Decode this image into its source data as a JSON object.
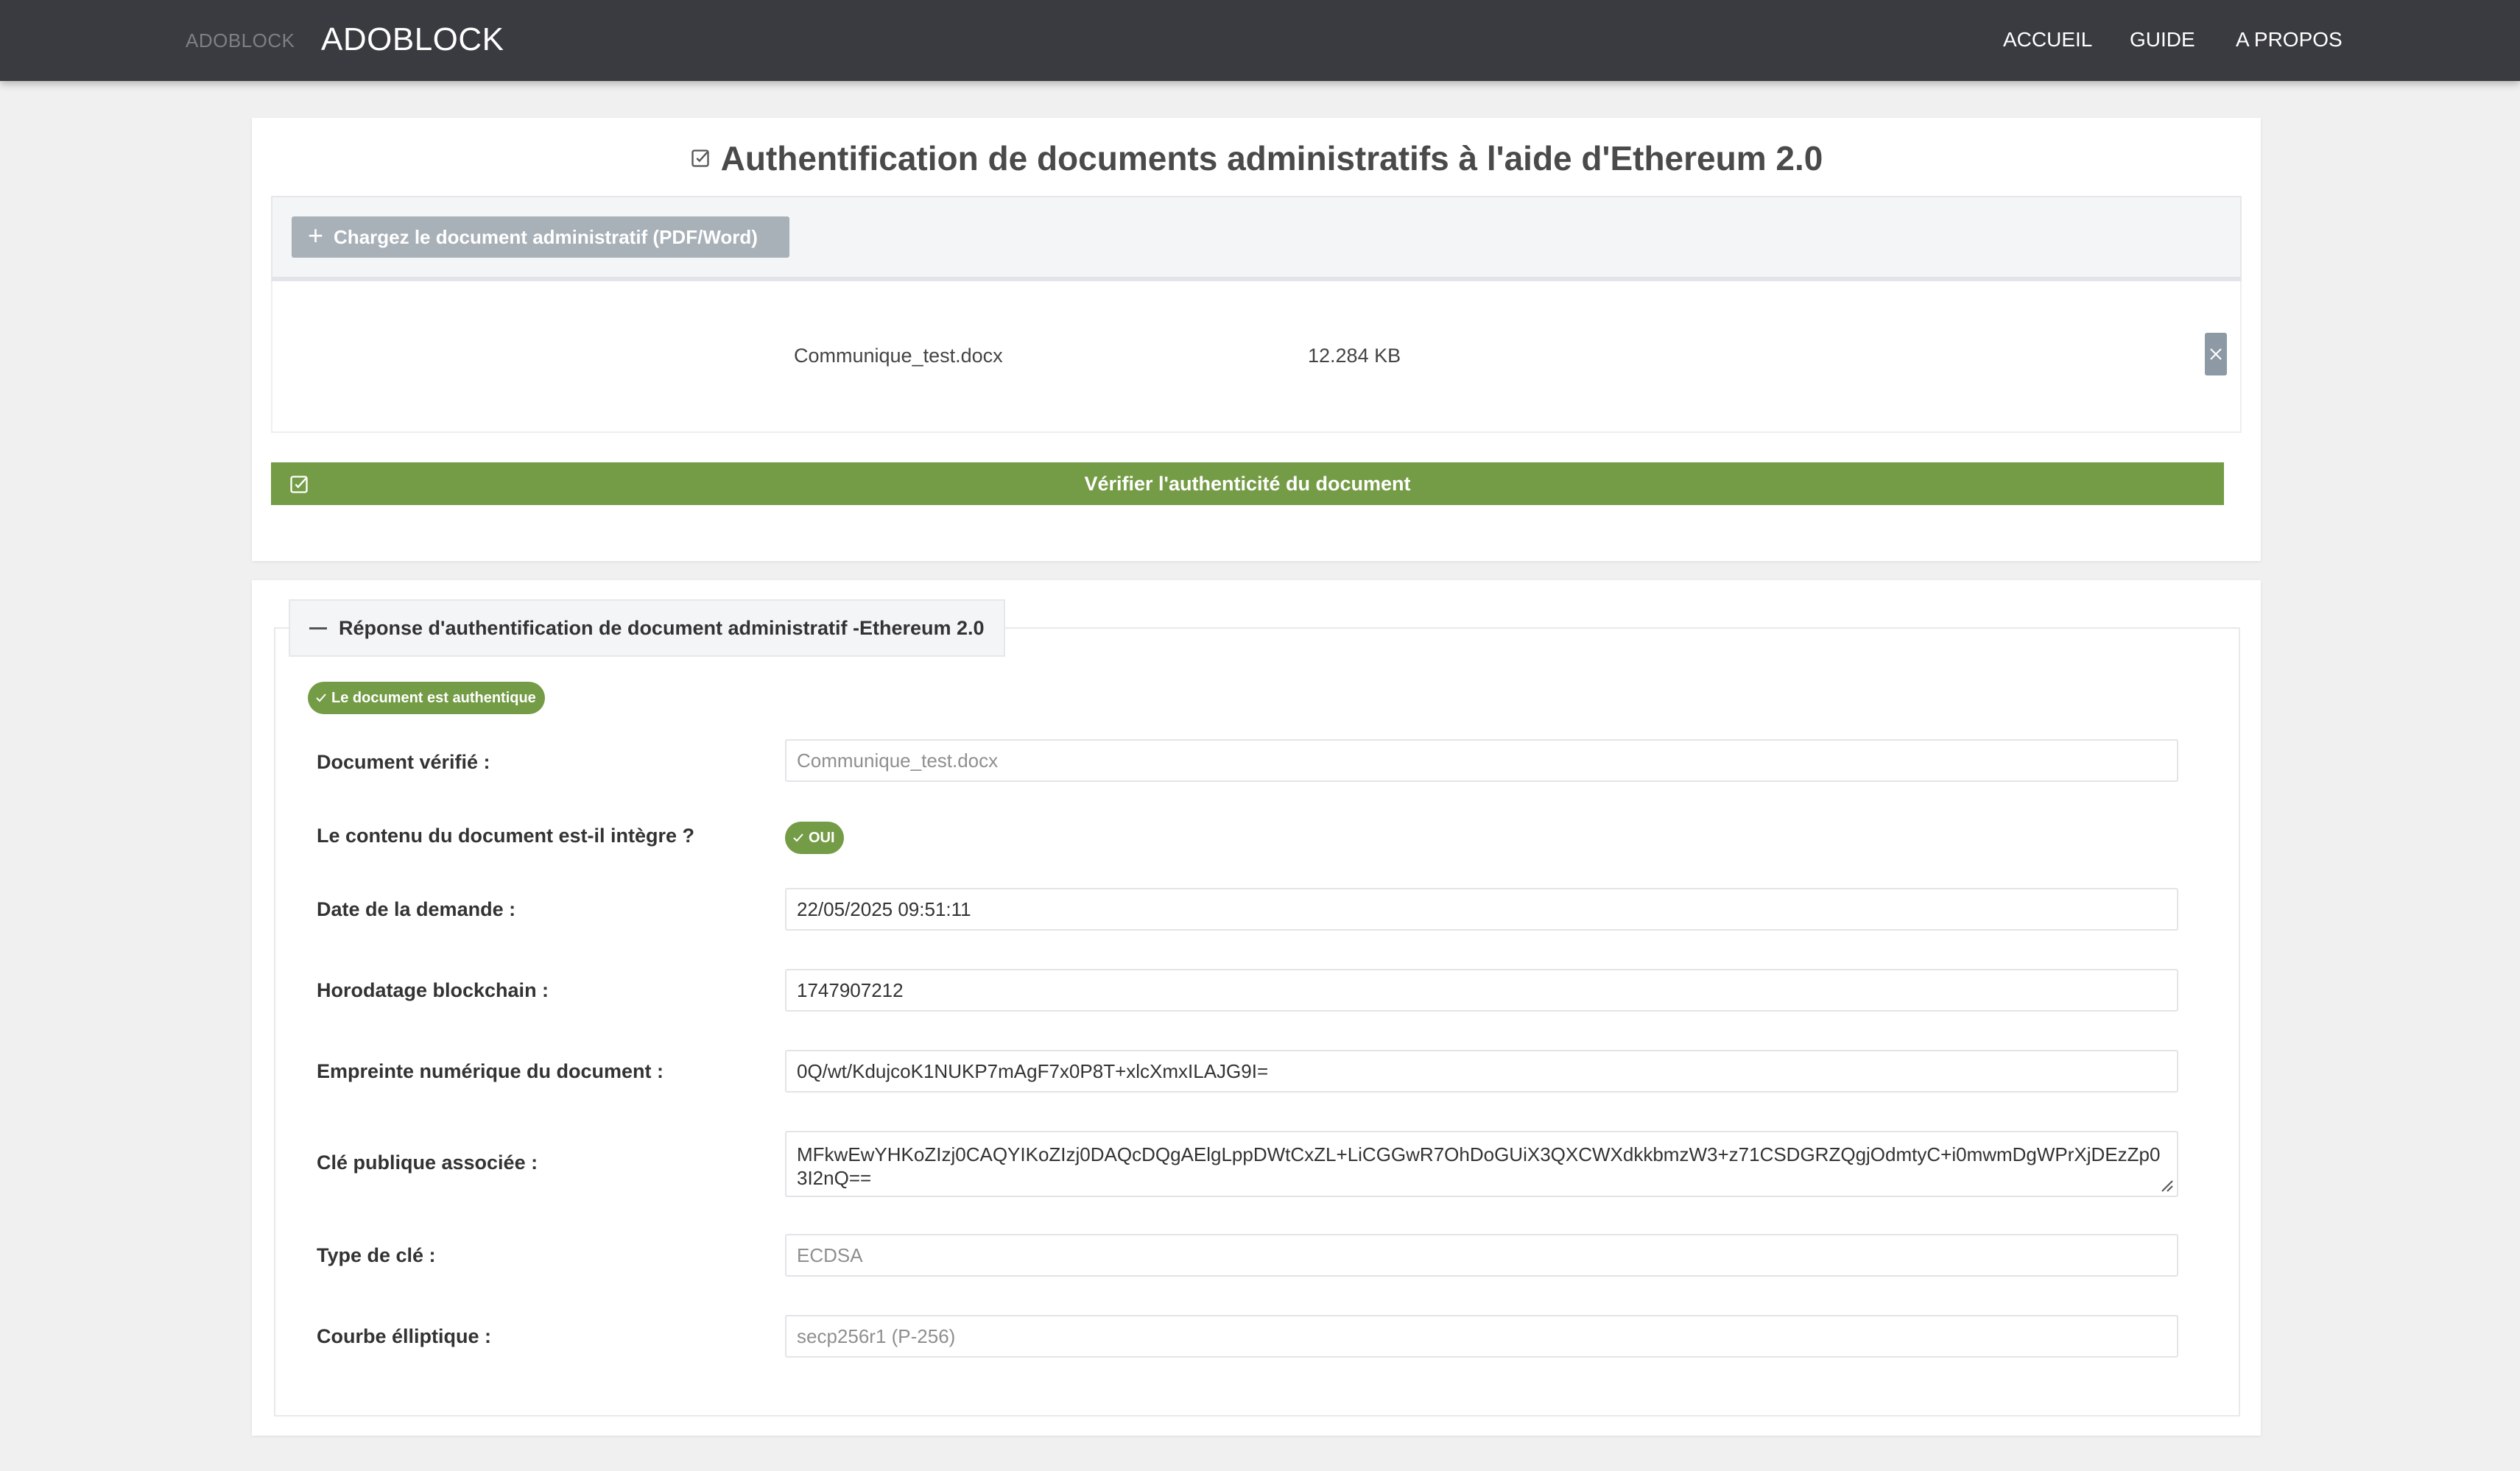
{
  "navbar": {
    "brand_small": "ADOBLOCK",
    "brand_main": "ADOBLOCK",
    "links": [
      "ACCUEIL",
      "GUIDE",
      "A PROPOS"
    ]
  },
  "upload": {
    "title": "Authentification de documents administratifs à l'aide d'Ethereum 2.0",
    "button_label": "Chargez le document administratif (PDF/Word)",
    "file": {
      "name": "Communique_test.docx",
      "size": "12.284 KB"
    },
    "verify_label": "Vérifier l'authenticité du document"
  },
  "response": {
    "legend": "Réponse d'authentification de document administratif -Ethereum 2.0",
    "status_badge": "Le document est authentique",
    "rows": {
      "document": {
        "label": "Document vérifié :",
        "value": "Communique_test.docx"
      },
      "integrity": {
        "label": "Le contenu du document est-il intègre ?",
        "value": "OUI"
      },
      "date": {
        "label": "Date de la demande :",
        "value": "22/05/2025 09:51:11"
      },
      "timestamp": {
        "label": "Horodatage blockchain :",
        "value": "1747907212"
      },
      "hash": {
        "label": "Empreinte numérique du document :",
        "value": "0Q/wt/KdujcoK1NUKP7mAgF7x0P8T+xlcXmxILAJG9I="
      },
      "pubkey": {
        "label": "Clé publique associée :",
        "value": "MFkwEwYHKoZIzj0CAQYIKoZIzj0DAQcDQgAElgLppDWtCxZL+LiCGGwR7OhDoGUiX3QXCWXdkkbmzW3+z71CSDGRZQgjOdmtyC+i0mwmDgWPrXjDEzZp03I2nQ=="
      },
      "keytype": {
        "label": "Type de clé :",
        "value": "ECDSA"
      },
      "curve": {
        "label": "Courbe élliptique :",
        "value": "secp256r1 (P-256)"
      }
    }
  },
  "colors": {
    "navbar": "#393b40",
    "accent_green": "#749b45",
    "upload_button": "#a8b0b8"
  }
}
